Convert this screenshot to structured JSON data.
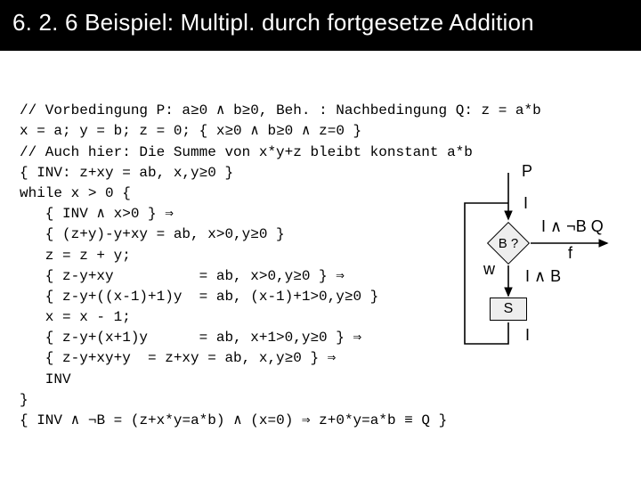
{
  "title": "6. 2. 6  Beispiel: Multipl. durch fortgesetze Addition",
  "code": {
    "l1": "// Vorbedingung P: a≥0 ∧ b≥0, Beh. : Nachbedingung Q: z = a*b",
    "l2": "x = a; y = b; z = 0; { x≥0 ∧ b≥0 ∧ z=0 }",
    "l3": "// Auch hier: Die Summe von x*y+z bleibt konstant a*b",
    "l4": "{ INV: z+xy = ab, x,y≥0 }",
    "l5": "while x > 0 {",
    "l6": "   { INV ∧ x>0 } ⇒",
    "l7": "   { (z+y)-y+xy = ab, x>0,y≥0 }",
    "l8": "   z = z + y;",
    "l9": "   { z-y+xy          = ab, x>0,y≥0 } ⇒",
    "l10": "   { z-y+((x-1)+1)y  = ab, (x-1)+1>0,y≥0 }",
    "l11": "   x = x - 1;",
    "l12": "   { z-y+(x+1)y      = ab, x+1>0,y≥0 } ⇒",
    "l13": "   { z-y+xy+y  = z+xy = ab, x,y≥0 } ⇒",
    "l14": "   INV",
    "l15": "}",
    "l16": "{ INV ∧ ¬B = (z+x*y=a*b) ∧ (x=0) ⇒ z+0*y=a*b ≡ Q }"
  },
  "diagram": {
    "p": "P",
    "i_top": "I",
    "b": "B ?",
    "q_label": "I ∧ ¬B Q",
    "f": "f",
    "w": "w",
    "iab": "I ∧ B",
    "s": "S",
    "i_bot": "I"
  }
}
